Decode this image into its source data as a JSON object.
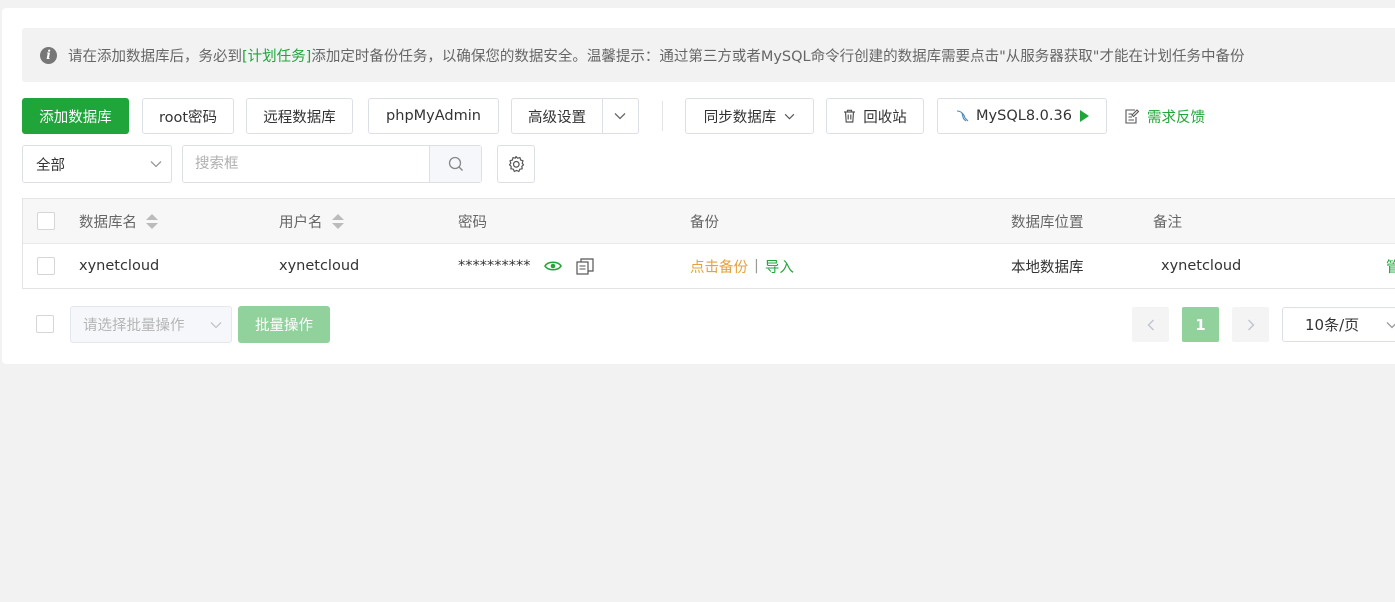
{
  "notice": {
    "text_before": "请在添加数据库后，务必到",
    "link": "[计划任务]",
    "text_after": "添加定时备份任务，以确保您的数据安全。温馨提示：通过第三方或者MySQL命令行创建的数据库需要点击\"从服务器获取\"才能在计划任务中备份"
  },
  "toolbar": {
    "add_database": "添加数据库",
    "root_password": "root密码",
    "remote_database": "远程数据库",
    "phpmyadmin": "phpMyAdmin",
    "advanced_settings": "高级设置",
    "sync_database": "同步数据库",
    "recycle_bin": "回收站",
    "mysql_version": "MySQL8.0.36",
    "feedback": "需求反馈"
  },
  "filter": {
    "selected": "全部",
    "search_placeholder": "搜索框"
  },
  "table": {
    "headers": {
      "name": "数据库名",
      "user": "用户名",
      "password": "密码",
      "backup": "备份",
      "location": "数据库位置",
      "remark": "备注"
    },
    "rows": [
      {
        "name": "xynetcloud",
        "user": "xynetcloud",
        "password": "**********",
        "backup_action": "点击备份",
        "backup_separator": "|",
        "import_action": "导入",
        "location": "本地数据库",
        "remark": "xynetcloud",
        "action_partial": "管"
      }
    ]
  },
  "batch": {
    "placeholder": "请选择批量操作",
    "button": "批量操作"
  },
  "pagination": {
    "prev": "‹",
    "current": "1",
    "next": "›",
    "page_size": "10条/页"
  },
  "colors": {
    "accent": "#20a53a",
    "accent_light": "#90d19c",
    "backup_link": "#e6a23c"
  }
}
